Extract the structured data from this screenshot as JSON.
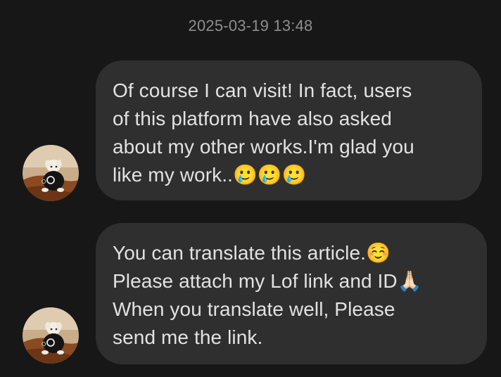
{
  "conversation": {
    "timestamp": "2025-03-19 13:48",
    "messages": [
      {
        "text": "Of course I can visit! In fact, users\nof this platform have also asked\nabout my other works.I'm glad you\nlike my work..🥲🥲🥲",
        "avatar_icon": "user-avatar-dog-photo"
      },
      {
        "text": "You can translate this article.☺️\nPlease attach my Lof link and ID🙏🏻\nWhen you translate well,  Please\nsend me the link.",
        "avatar_icon": "user-avatar-dog-photo"
      }
    ]
  },
  "colors": {
    "background": "#171717",
    "bubble": "#2f2f2f",
    "text": "#e2e2e2",
    "timestamp": "#8e8e8e"
  }
}
